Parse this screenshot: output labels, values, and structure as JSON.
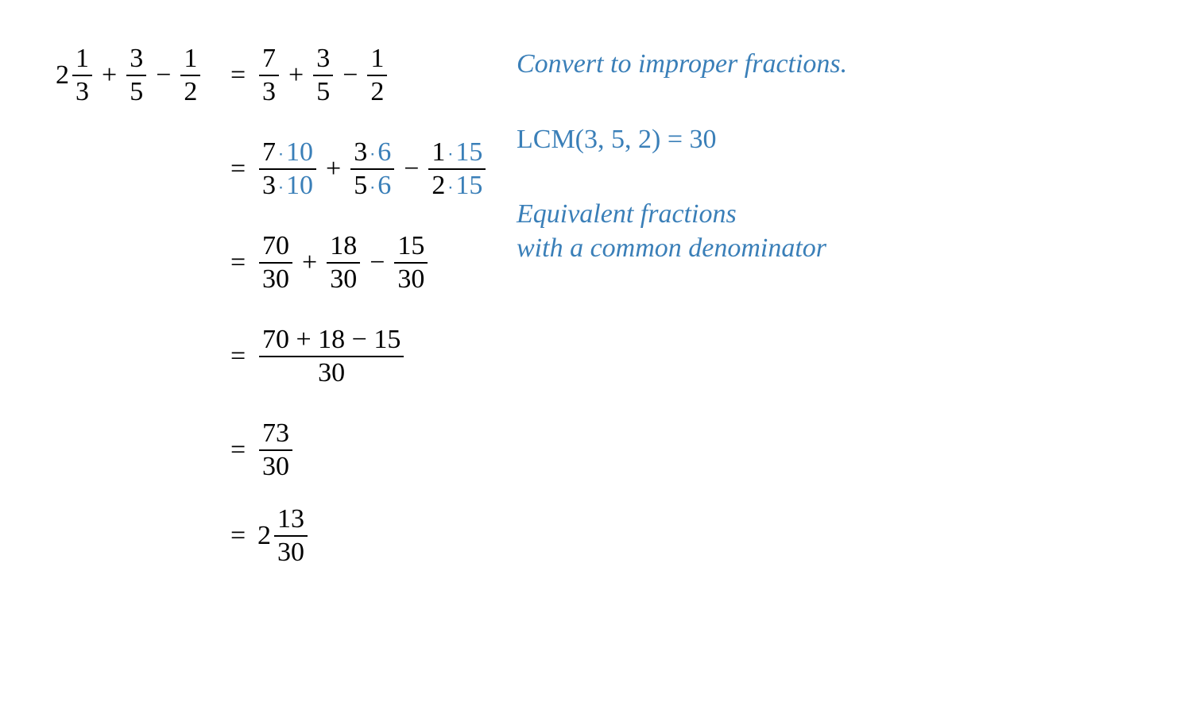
{
  "colors": {
    "highlight": "#3a7fb8"
  },
  "lhs": {
    "mixed_whole": "2",
    "f1": {
      "num": "1",
      "den": "3"
    },
    "op1": "+",
    "f2": {
      "num": "3",
      "den": "5"
    },
    "op2": "−",
    "f3": {
      "num": "1",
      "den": "2"
    }
  },
  "steps": {
    "s1": {
      "f1": {
        "num": "7",
        "den": "3"
      },
      "op1": "+",
      "f2": {
        "num": "3",
        "den": "5"
      },
      "op2": "−",
      "f3": {
        "num": "1",
        "den": "2"
      }
    },
    "s2": {
      "f1": {
        "num_a": "7",
        "num_b": "10",
        "den_a": "3",
        "den_b": "10"
      },
      "op1": "+",
      "f2": {
        "num_a": "3",
        "num_b": "6",
        "den_a": "5",
        "den_b": "6"
      },
      "op2": "−",
      "f3": {
        "num_a": "1",
        "num_b": "15",
        "den_a": "2",
        "den_b": "15"
      }
    },
    "s3": {
      "f1": {
        "num": "70",
        "den": "30"
      },
      "op1": "+",
      "f2": {
        "num": "18",
        "den": "30"
      },
      "op2": "−",
      "f3": {
        "num": "15",
        "den": "30"
      }
    },
    "s4": {
      "num_expr": "70 + 18 − 15",
      "den": "30"
    },
    "s5": {
      "num": "73",
      "den": "30"
    },
    "s6": {
      "whole": "2",
      "num": "13",
      "den": "30"
    }
  },
  "eq": "=",
  "dot": "⋅",
  "annotations": {
    "a1": "Convert to improper fractions.",
    "a2": "LCM(3,  5,  2)   =   30",
    "a3_line1": "Equivalent fractions",
    "a3_line2": "with a common denominator"
  }
}
